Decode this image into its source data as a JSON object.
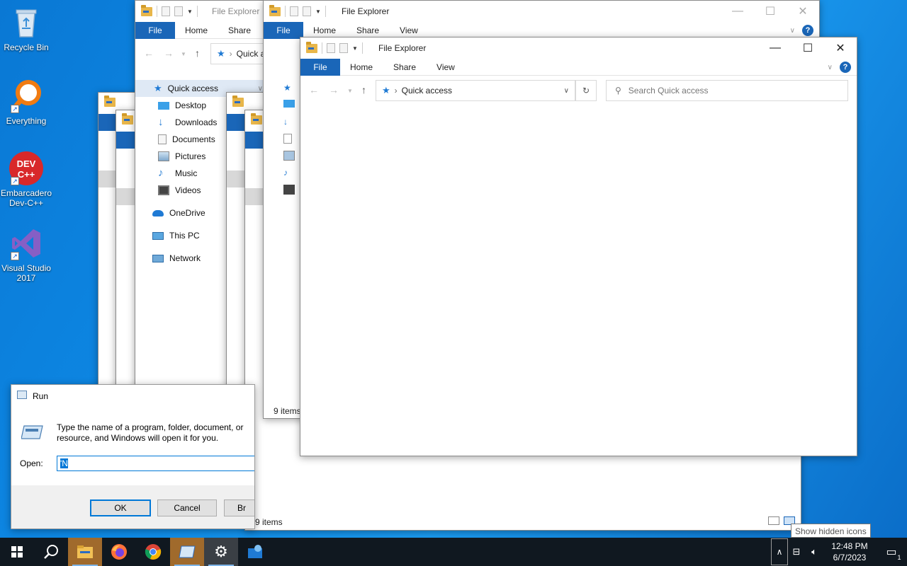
{
  "desktop": {
    "icons": [
      {
        "label": "Recycle Bin"
      },
      {
        "label": "Everything"
      },
      {
        "label": "Embarcadero Dev-C++",
        "glyph": "DEV C++"
      },
      {
        "label": "Visual Studio 2017"
      }
    ]
  },
  "explorer_back2": {
    "title": "File Explorer",
    "tabs": {
      "file": "File",
      "home": "Home",
      "share": "Share"
    },
    "address": "Quick a",
    "nav": [
      "Quick access",
      "Desktop",
      "Downloads",
      "Documents",
      "Pictures",
      "Music",
      "Videos",
      "OneDrive",
      "This PC",
      "Network"
    ]
  },
  "explorer_back1": {
    "title": "File Explorer",
    "tabs": {
      "file": "File",
      "home": "Home",
      "share": "Share",
      "view": "View"
    },
    "status": "9 items"
  },
  "explorer_main": {
    "title": "File Explorer",
    "tabs": {
      "file": "File",
      "home": "Home",
      "share": "Share",
      "view": "View"
    },
    "address": "Quick access",
    "search_placeholder": "Search Quick access"
  },
  "explorer_bottom": {
    "status": "9 items"
  },
  "run": {
    "title": "Run",
    "description_line1": "Type the name of a program, folder, document, or",
    "description_line2": "resource, and Windows will open it for you.",
    "open_label": "Open:",
    "open_value": "'N",
    "ok": "OK",
    "cancel": "Cancel",
    "browse": "Br"
  },
  "tooltip": "Show hidden icons",
  "taskbar": {
    "time": "12:48 PM",
    "date": "6/7/2023",
    "notification_count": "1"
  },
  "colors": {
    "accent": "#1a66b8",
    "taskbar": "#101820",
    "desktop": "#0e8ae6"
  }
}
